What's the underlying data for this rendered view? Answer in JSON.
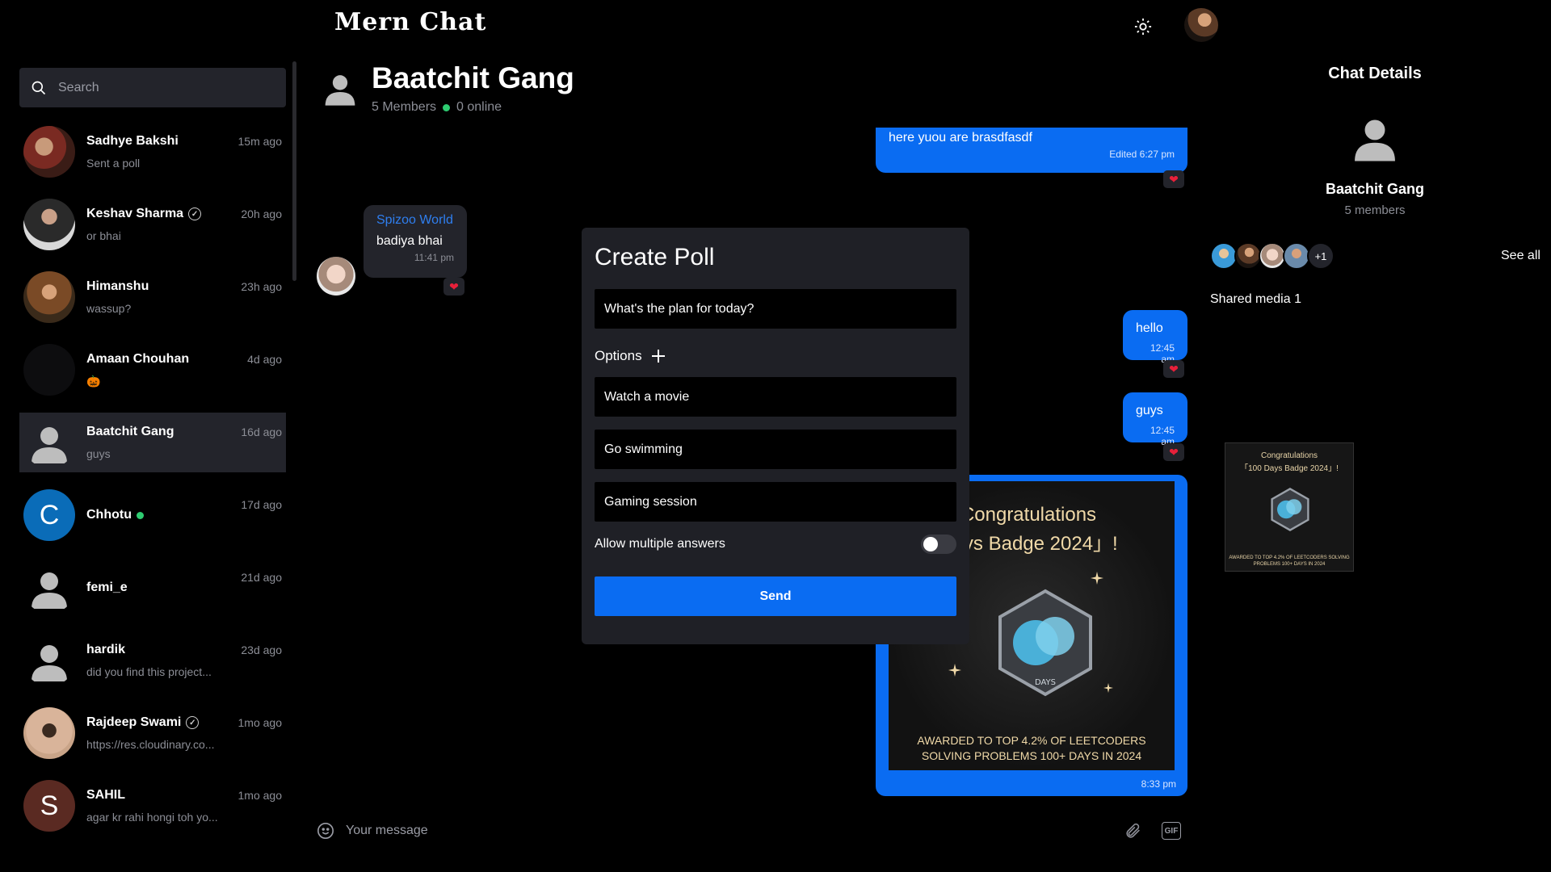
{
  "app": {
    "title": "Mern Chat"
  },
  "sidebar": {
    "search_placeholder": "Search",
    "chats": [
      {
        "name": "Sadhye Bakshi",
        "last": "Sent a poll",
        "time": "15m ago",
        "verified": false,
        "online": false
      },
      {
        "name": "Keshav Sharma",
        "last": "or bhai",
        "time": "20h ago",
        "verified": true,
        "online": false
      },
      {
        "name": "Himanshu",
        "last": "wassup?",
        "time": "23h ago",
        "verified": false,
        "online": false
      },
      {
        "name": "Amaan Chouhan",
        "last": "🎃",
        "time": "4d ago",
        "verified": false,
        "online": false
      },
      {
        "name": "Baatchit Gang",
        "last": "guys",
        "time": "16d ago",
        "verified": false,
        "online": false,
        "active": true
      },
      {
        "name": "Chhotu",
        "last": "",
        "time": "17d ago",
        "verified": false,
        "online": true,
        "letter": "C"
      },
      {
        "name": "femi_e",
        "last": "",
        "time": "21d ago",
        "verified": false,
        "online": false
      },
      {
        "name": "hardik",
        "last": "did you find this project...",
        "time": "23d ago",
        "verified": false,
        "online": false
      },
      {
        "name": "Rajdeep Swami",
        "last": "https://res.cloudinary.co...",
        "time": "1mo ago",
        "verified": true,
        "online": false
      },
      {
        "name": "SAHIL",
        "last": "agar kr rahi hongi toh yo...",
        "time": "1mo ago",
        "verified": false,
        "online": false,
        "letter": "S"
      }
    ]
  },
  "conversation": {
    "title": "Baatchit Gang",
    "members": "5 Members",
    "online": "0 online",
    "messages": {
      "m1_text": "here yuou are brasdfasdf",
      "m1_meta": "Edited 6:27 pm",
      "m2_sender": "Spizoo World",
      "m2_text": "badiya bhai",
      "m2_meta": "11:41 pm",
      "m3_text": "hello",
      "m3_meta": "12:45 am",
      "m4_text": "guys",
      "m4_meta": "12:45 am",
      "m5_line1": "Congratulations",
      "m5_line2": "Days Badge 2024」!",
      "m5_award1": "AWARDED TO TOP 4.2% OF LEETCODERS",
      "m5_award2": "SOLVING PROBLEMS 100+ DAYS IN 2024",
      "m5_meta": "8:33 pm"
    },
    "composer_placeholder": "Your message",
    "gif_label": "GIF"
  },
  "poll": {
    "title": "Create Poll",
    "question": "What's the plan for today?",
    "options_label": "Options",
    "options": [
      "Watch a movie",
      "Go swimming",
      "Gaming session"
    ],
    "multiple_label": "Allow multiple answers",
    "multiple_enabled": false,
    "send_label": "Send"
  },
  "details": {
    "title": "Chat Details",
    "name": "Baatchit Gang",
    "members": "5 members",
    "more_members": "+1",
    "see_all": "See all",
    "shared_media": "Shared media 1",
    "thumb_line1": "Congratulations",
    "thumb_line2": "「100 Days Badge 2024」!",
    "thumb_award": "AWARDED TO TOP 4.2% OF LEETCODERS SOLVING PROBLEMS 100+ DAYS IN 2024"
  },
  "colors": {
    "accent": "#0a6cf2",
    "panel": "#23242b",
    "online": "#2ecc71",
    "heart": "#e8203a"
  }
}
